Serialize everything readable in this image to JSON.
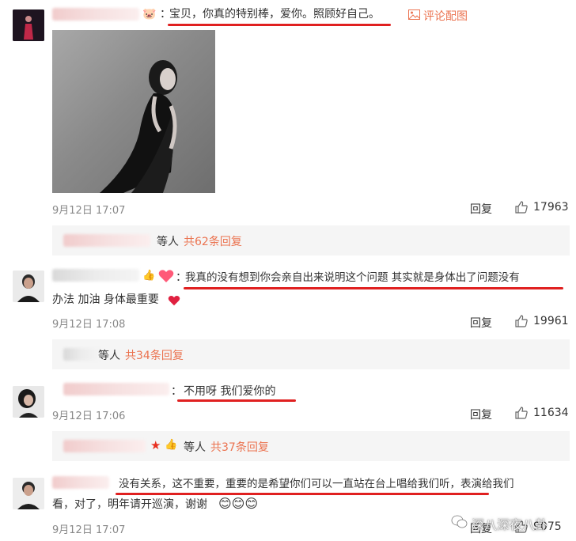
{
  "comments": [
    {
      "text": "宝贝，你真的特别棒，爱你。照顾好自己。",
      "separator": "：",
      "action_link": "评论配图",
      "date": "9月12日 17:07",
      "reply_label": "回复",
      "likes": "17963",
      "replies_summary": {
        "suffix": "等人",
        "count_text": "共62条回复"
      }
    },
    {
      "text_line1": "我真的没有想到你会亲自出来说明这个问题 其实就是身体出了问题没有",
      "text_line2": "办法 加油 身体最重要",
      "separator": "：",
      "date": "9月12日 17:08",
      "reply_label": "回复",
      "likes": "19961",
      "replies_summary": {
        "suffix": "等人",
        "count_text": "共34条回复"
      }
    },
    {
      "text": "不用呀 我们爱你的",
      "separator": "：",
      "date": "9月12日 17:06",
      "reply_label": "回复",
      "likes": "11634",
      "replies_summary": {
        "suffix": "等人",
        "count_text": "共37条回复"
      }
    },
    {
      "text_line1": "没有关系，这不重要，重要的是希望你们可以一直站在台上唱给我们听，表演给我们",
      "text_line2": "看，对了，明年请开巡演，谢谢",
      "date": "9月12日 17:07",
      "reply_label": "回复",
      "likes": "9075"
    }
  ],
  "watermark": "深八深夜八卦",
  "colors": {
    "accent": "#eb7350",
    "underline": "#e02020",
    "box": "#f5f5f5"
  }
}
